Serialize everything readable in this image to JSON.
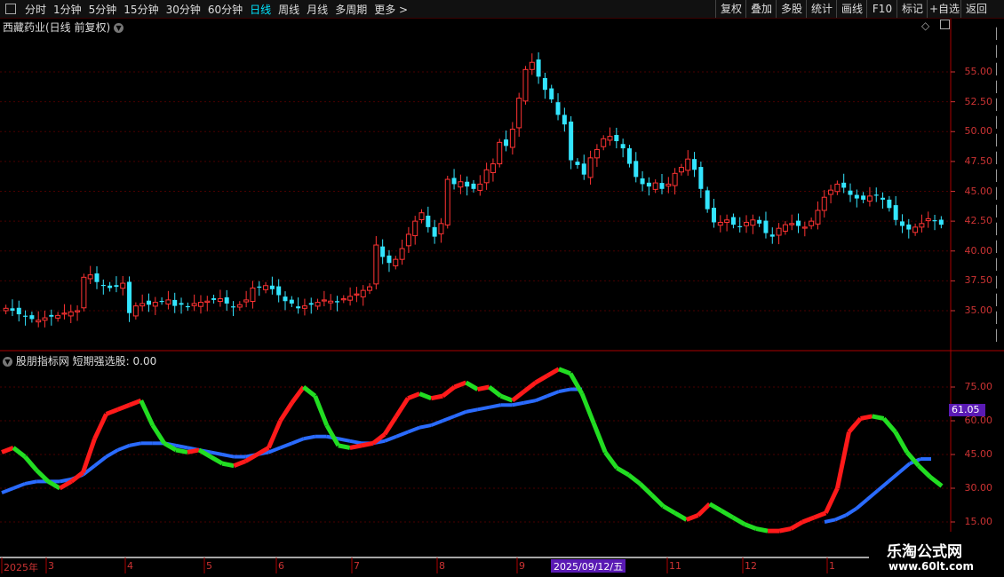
{
  "toolbar": {
    "timeframes": [
      "分时",
      "1分钟",
      "5分钟",
      "15分钟",
      "30分钟",
      "60分钟",
      "日线",
      "周线",
      "月线",
      "多周期",
      "更多 >"
    ],
    "active_index": 6,
    "right_buttons": [
      "复权",
      "叠加",
      "多股",
      "统计",
      "画线",
      "F10",
      "标记",
      "+自选",
      "返回"
    ]
  },
  "main_chart": {
    "title": "西藏药业(日线 前复权)",
    "y_ticks": [
      "55.00",
      "52.50",
      "50.00",
      "47.50",
      "45.00",
      "42.50",
      "40.00",
      "37.50",
      "35.00"
    ],
    "y_values": [
      55,
      52.5,
      50,
      47.5,
      45,
      42.5,
      40,
      37.5,
      35
    ]
  },
  "indicator": {
    "title": "股朋指标网 短期强选股: 0.00",
    "y_ticks": [
      "75.00",
      "60.00",
      "45.00",
      "30.00",
      "15.00"
    ],
    "y_values": [
      75,
      60,
      45,
      30,
      15
    ],
    "current_value": "61.05"
  },
  "x_axis": {
    "labels": [
      "2025年",
      "3",
      "4",
      "5",
      "6",
      "7",
      "8",
      "9",
      "11",
      "12",
      "1"
    ],
    "cursor_label": "2025/09/12/五"
  },
  "watermark": {
    "name": "乐淘公式网",
    "url": "www.60lt.com"
  },
  "colors": {
    "up": "#ff3333",
    "down": "#33e5ff",
    "grid": "#4a0000",
    "line_up": "#ff1a1a",
    "line_down": "#22dd22",
    "line_slow": "#2a6bff",
    "axis": "#cc3333"
  },
  "chart_data": [
    {
      "type": "candlestick",
      "title": "西藏药业(日线 前复权)",
      "ylim": [
        32.5,
        57.5
      ],
      "close_series": [
        35.2,
        35.0,
        34.7,
        34.5,
        34.3,
        34.2,
        34.4,
        34.5,
        34.6,
        34.8,
        34.9,
        35.0,
        37.8,
        38.0,
        37.4,
        37.1,
        36.9,
        37.0,
        37.3,
        34.8,
        35.4,
        35.6,
        35.5,
        35.7,
        35.8,
        35.9,
        35.4,
        35.5,
        35.3,
        35.6,
        35.7,
        35.8,
        35.9,
        36.0,
        35.6,
        35.3,
        35.5,
        35.9,
        36.9,
        37.0,
        37.1,
        36.8,
        36.3,
        35.8,
        35.6,
        35.2,
        35.4,
        35.5,
        35.7,
        35.9,
        35.8,
        35.7,
        36.0,
        36.2,
        36.4,
        36.7,
        37.0,
        40.5,
        39.5,
        39.0,
        39.3,
        40.2,
        41.4,
        42.5,
        43.2,
        42.0,
        41.2,
        42.3,
        46.0,
        45.6,
        45.8,
        45.4,
        45.2,
        45.6,
        46.8,
        47.3,
        49.1,
        48.8,
        50.2,
        52.8,
        55.2,
        55.8,
        54.6,
        53.5,
        52.7,
        51.4,
        50.6,
        47.6,
        47.2,
        46.4,
        47.8,
        48.5,
        49.4,
        49.6,
        49.2,
        48.6,
        47.3,
        46.2,
        45.6,
        45.4,
        45.7,
        45.2,
        45.6,
        46.5,
        47.0,
        47.7,
        46.8,
        45.2,
        43.5,
        42.4,
        42.4,
        42.6,
        42.2,
        42.0,
        42.4,
        42.6,
        42.3,
        41.5,
        41.2,
        41.9,
        42.2,
        42.3,
        42.1,
        42.0,
        42.5,
        43.4,
        44.5,
        45.1,
        45.6,
        45.3,
        44.7,
        44.4,
        44.3,
        44.6,
        44.7,
        44.3,
        43.6,
        42.6,
        42.1,
        41.8,
        42.0,
        42.3,
        42.7,
        42.5,
        42.2
      ]
    },
    {
      "type": "line",
      "title": "股朋指标网 短期强选股",
      "ylim": [
        5,
        85
      ],
      "series": [
        {
          "name": "fast",
          "values": [
            46,
            48,
            44,
            38,
            33,
            30,
            33,
            37,
            52,
            63,
            65,
            67,
            69,
            58,
            50,
            47,
            46,
            47,
            44,
            41,
            40,
            42,
            45,
            48,
            60,
            68,
            75,
            71,
            58,
            49,
            48,
            49,
            50,
            54,
            62,
            70,
            72,
            70,
            71,
            75,
            77,
            74,
            75,
            71,
            69,
            73,
            77,
            80,
            83,
            81,
            72,
            59,
            46,
            39,
            36,
            32,
            27,
            22,
            19,
            16,
            18,
            23,
            20,
            17,
            14,
            12,
            11,
            11,
            12,
            15,
            17,
            19,
            30,
            55,
            61,
            62,
            61,
            55,
            46,
            40,
            35,
            31
          ]
        },
        {
          "name": "slow",
          "values": [
            28,
            30,
            32,
            33,
            33,
            33,
            34,
            36,
            40,
            44,
            47,
            49,
            50,
            50,
            50,
            49,
            48,
            47,
            46,
            45,
            44,
            44,
            45,
            46,
            48,
            50,
            52,
            53,
            53,
            52,
            51,
            50,
            50,
            51,
            53,
            55,
            57,
            58,
            60,
            62,
            64,
            65,
            66,
            67,
            67,
            68,
            69,
            71,
            73,
            74,
            74
          ]
        }
      ]
    }
  ]
}
